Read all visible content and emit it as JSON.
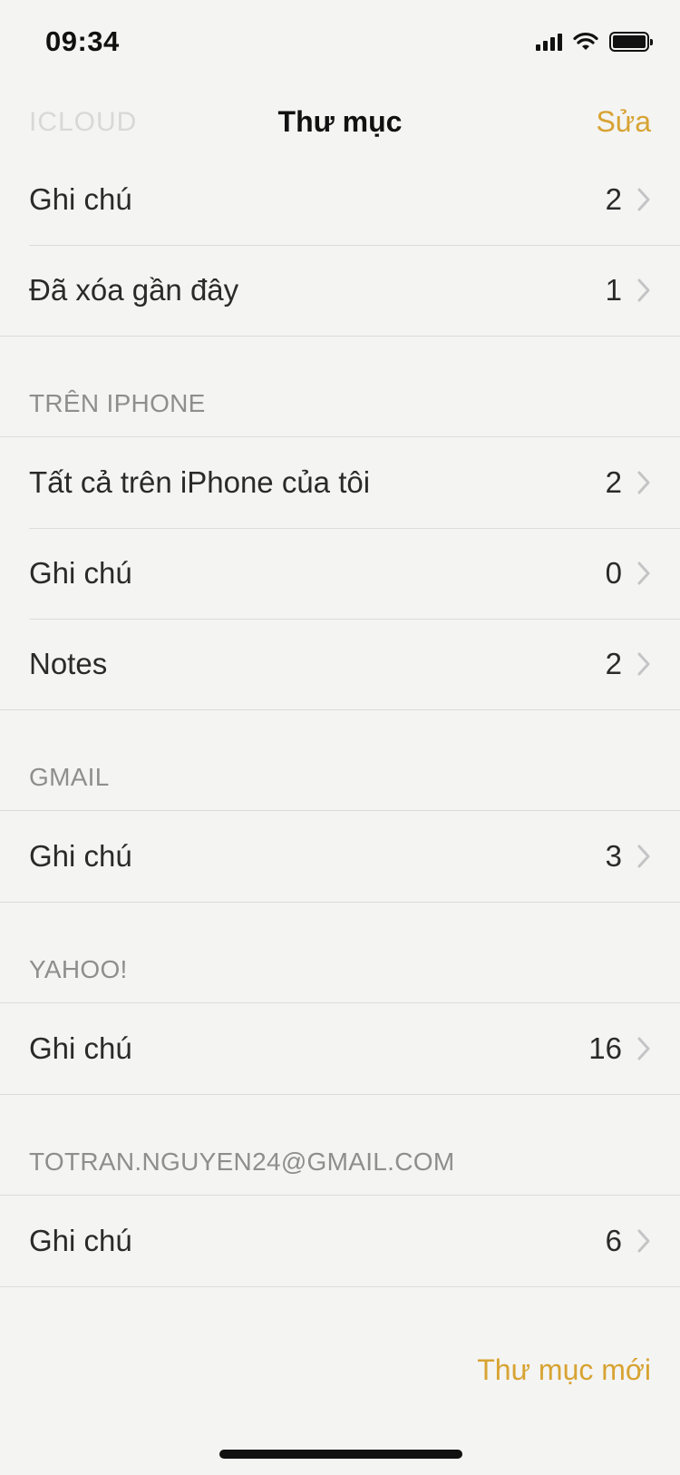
{
  "status_bar": {
    "time": "09:34"
  },
  "nav": {
    "back_label": "ICLOUD",
    "title": "Thư mục",
    "edit_label": "Sửa"
  },
  "sections": [
    {
      "header": "",
      "rows": [
        {
          "label": "Ghi chú",
          "count": "2"
        },
        {
          "label": "Đã xóa gần đây",
          "count": "1"
        }
      ]
    },
    {
      "header": "TRÊN IPHONE",
      "rows": [
        {
          "label": "Tất cả trên iPhone của tôi",
          "count": "2"
        },
        {
          "label": "Ghi chú",
          "count": "0"
        },
        {
          "label": "Notes",
          "count": "2"
        }
      ]
    },
    {
      "header": "GMAIL",
      "rows": [
        {
          "label": "Ghi chú",
          "count": "3"
        }
      ]
    },
    {
      "header": "YAHOO!",
      "rows": [
        {
          "label": "Ghi chú",
          "count": "16"
        }
      ]
    },
    {
      "header": "TOTRAN.NGUYEN24@GMAIL.COM",
      "rows": [
        {
          "label": "Ghi chú",
          "count": "6"
        }
      ]
    }
  ],
  "footer": {
    "new_folder_label": "Thư mục mới"
  },
  "colors": {
    "accent": "#d7a332",
    "background": "#f4f4f2",
    "separator": "#dcdcd9"
  },
  "icons": [
    "signal-icon",
    "wifi-icon",
    "battery-icon",
    "chevron-right-icon"
  ]
}
